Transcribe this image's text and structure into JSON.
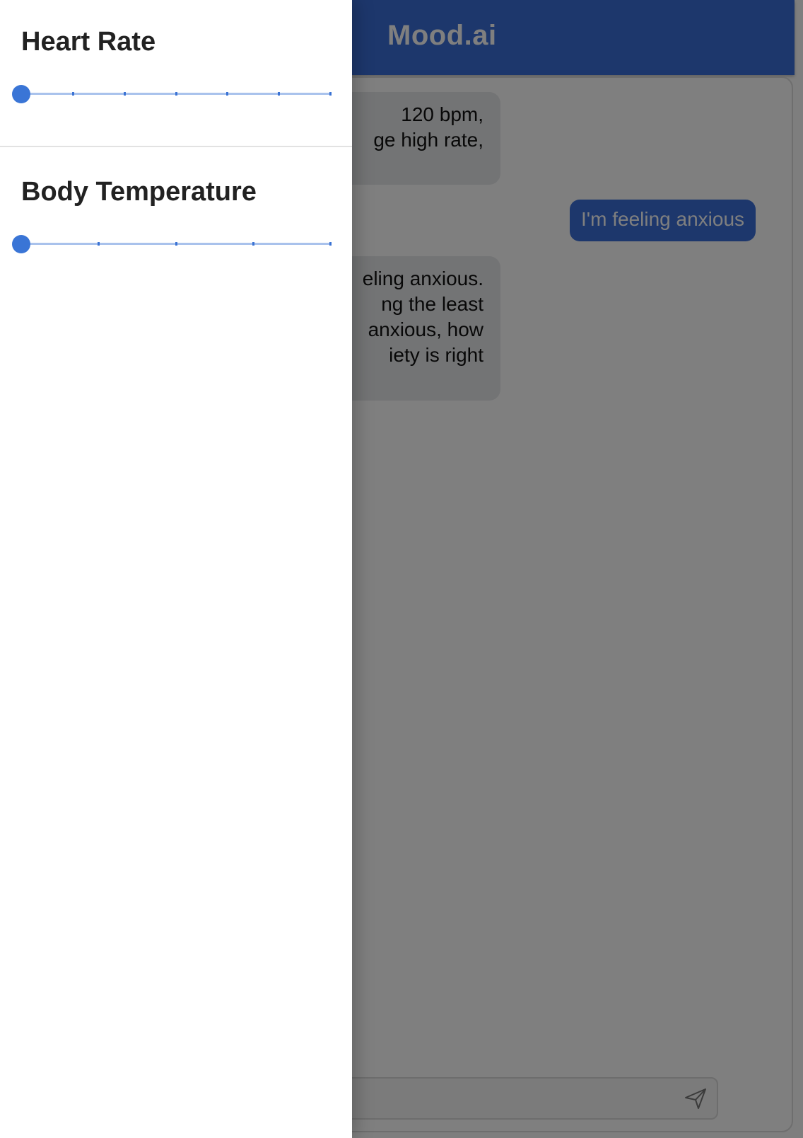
{
  "app": {
    "title": "Mood.ai",
    "accent_color": "#3b6fd9"
  },
  "chat": {
    "messages": [
      {
        "role": "bot",
        "text_lines": [
          "120 bpm,",
          "ge high rate,"
        ]
      },
      {
        "role": "user",
        "text": "I'm feeling anxious"
      },
      {
        "role": "bot",
        "text_lines": [
          "eling anxious.",
          "ng the least",
          "anxious, how",
          "iety is right"
        ]
      }
    ],
    "send_icon": "send-icon"
  },
  "drawer": {
    "sections": [
      {
        "title": "Heart Rate",
        "slider": {
          "value_fraction": 0.0,
          "tick_count": 7
        }
      },
      {
        "title": "Body Temperature",
        "slider": {
          "value_fraction": 0.0,
          "tick_count": 5
        }
      }
    ]
  }
}
